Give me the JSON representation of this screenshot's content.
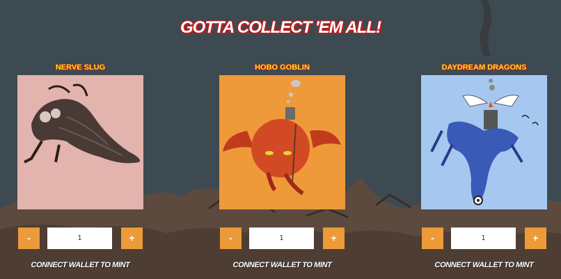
{
  "page": {
    "title": "GOTTA COLLECT 'EM ALL!"
  },
  "colors": {
    "background": "#3e4a52",
    "accent": "#ec9a3a",
    "title_text": "#ffffff",
    "title_outline": "#c41a1a",
    "card_name": "#f2e32c"
  },
  "cards": [
    {
      "name": "NERVE SLUG",
      "art_background": "#e3b3ae",
      "art_icon": "nerve-slug-illustration",
      "quantity": "1",
      "minus_label": "-",
      "plus_label": "+",
      "action_label": "CONNECT WALLET TO MINT"
    },
    {
      "name": "HOBO GOBLIN",
      "art_background": "#ee9a3a",
      "art_icon": "hobo-goblin-illustration",
      "quantity": "1",
      "minus_label": "-",
      "plus_label": "+",
      "action_label": "CONNECT WALLET TO MINT"
    },
    {
      "name": "DAYDREAM DRAGONS",
      "art_background": "#a6c8f0",
      "art_icon": "daydream-dragon-illustration",
      "quantity": "1",
      "minus_label": "-",
      "plus_label": "+",
      "action_label": "CONNECT WALLET TO MINT"
    }
  ]
}
